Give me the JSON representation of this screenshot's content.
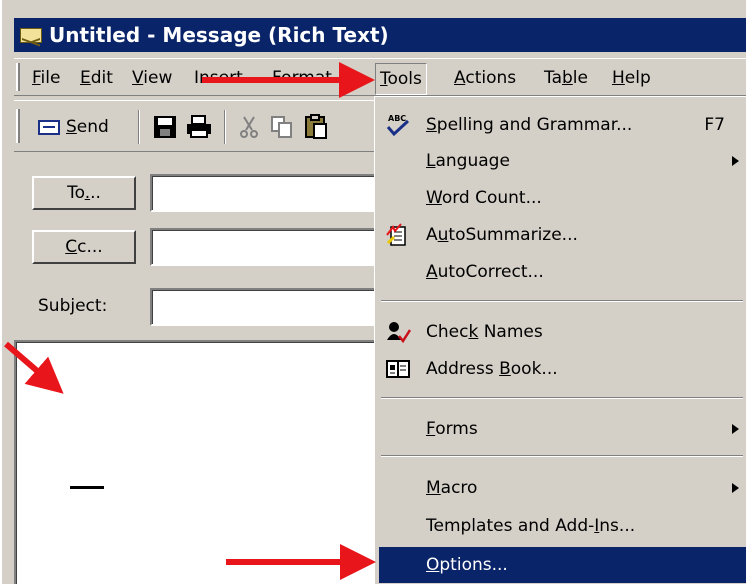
{
  "window": {
    "title": "Untitled - Message (Rich Text)"
  },
  "menubar": {
    "items": [
      {
        "label": "File",
        "underline": "F",
        "rest": "ile"
      },
      {
        "label": "Edit",
        "underline": "E",
        "rest": "dit"
      },
      {
        "label": "View",
        "underline": "V",
        "rest": "iew"
      },
      {
        "label": "Insert"
      },
      {
        "label": "Format"
      },
      {
        "label": "Tools",
        "underline": "T",
        "rest": "ools"
      },
      {
        "label": "Actions",
        "underline": "A",
        "rest": "ctions"
      },
      {
        "label": "Table",
        "pre": "Ta",
        "underline": "b",
        "rest": "le"
      },
      {
        "label": "Help",
        "underline": "H",
        "rest": "elp"
      }
    ]
  },
  "toolbar": {
    "send_pre": "",
    "send_u": "S",
    "send_rest": "end"
  },
  "address": {
    "to_label_pre": "To",
    "to_label_u": ".",
    "to_label_rest": "..",
    "cc_label_u": "C",
    "cc_label_rest": "c...",
    "subject_pre": "Sub",
    "subject_u": "j",
    "subject_rest": "ect:"
  },
  "tools_menu": {
    "items": [
      {
        "id": "spelling",
        "pre": "",
        "u": "S",
        "rest": "pelling and Grammar...",
        "shortcut": "F7",
        "icon": "spelling-icon",
        "submenu": false
      },
      {
        "id": "language",
        "pre": "",
        "u": "L",
        "rest": "anguage",
        "submenu": true
      },
      {
        "id": "wordcount",
        "pre": "",
        "u": "W",
        "rest": "ord Count...",
        "submenu": false
      },
      {
        "id": "autosummarize",
        "pre": "A",
        "u": "u",
        "rest": "toSummarize...",
        "icon": "autosummarize-icon",
        "submenu": false
      },
      {
        "id": "autocorrect",
        "pre": "",
        "u": "A",
        "rest": "utoCorrect...",
        "submenu": false
      },
      {
        "id": "checknames",
        "pre": "Chec",
        "u": "k",
        "rest": " Names",
        "icon": "check-names-icon",
        "submenu": false
      },
      {
        "id": "addressbook",
        "pre": "Address ",
        "u": "B",
        "rest": "ook...",
        "icon": "address-book-icon",
        "submenu": false
      },
      {
        "id": "forms",
        "pre": "",
        "u": "F",
        "rest": "orms",
        "submenu": true
      },
      {
        "id": "macro",
        "pre": "",
        "u": "M",
        "rest": "acro",
        "submenu": true
      },
      {
        "id": "templates",
        "pre": "Templates and Add-",
        "u": "I",
        "rest": "ns...",
        "submenu": false
      },
      {
        "id": "options",
        "pre": "",
        "u": "O",
        "rest": "ptions...",
        "submenu": false,
        "highlighted": true
      }
    ]
  },
  "colors": {
    "titlebar": "#0a246a",
    "chrome": "#d4d0c8",
    "highlight": "#0a246a",
    "annotation_arrow": "#e8151b"
  }
}
